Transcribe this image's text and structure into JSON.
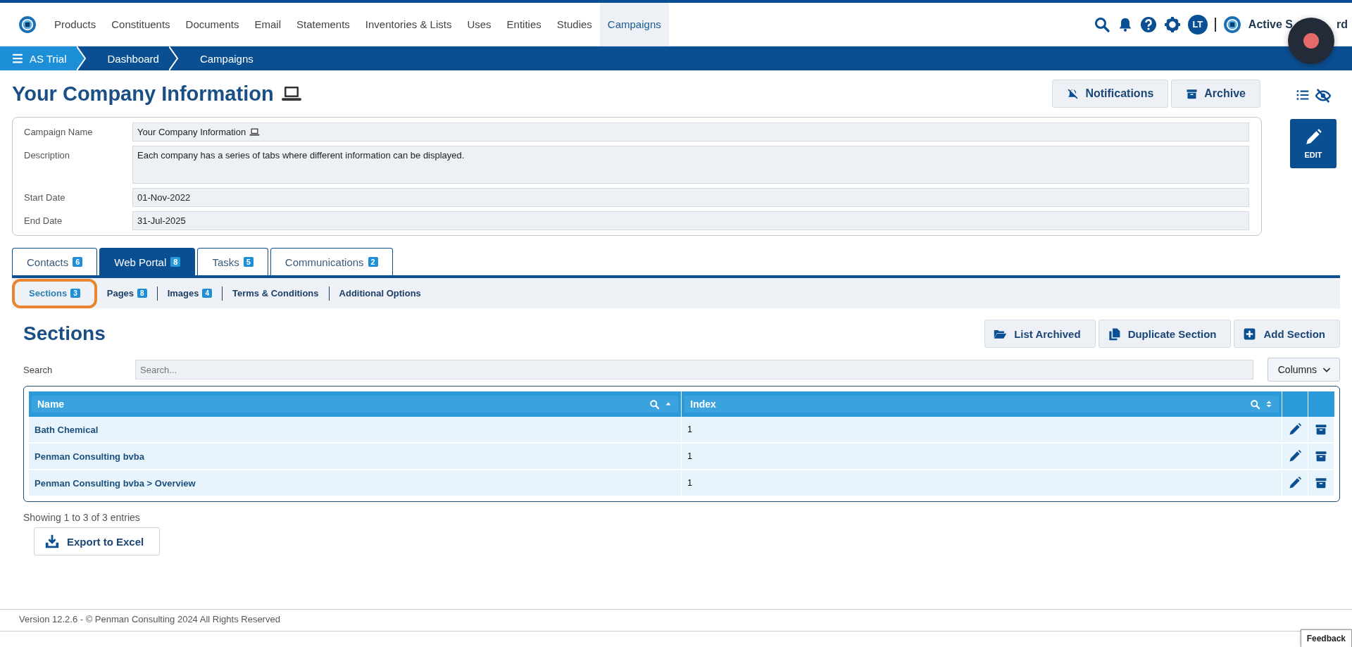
{
  "nav": {
    "items": [
      {
        "label": "Products",
        "selected": false
      },
      {
        "label": "Constituents",
        "selected": false
      },
      {
        "label": "Documents",
        "selected": false
      },
      {
        "label": "Email",
        "selected": false
      },
      {
        "label": "Statements",
        "selected": false
      },
      {
        "label": "Inventories & Lists",
        "selected": false
      },
      {
        "label": "Uses",
        "selected": false
      },
      {
        "label": "Entities",
        "selected": false
      },
      {
        "label": "Studies",
        "selected": false
      },
      {
        "label": "Campaigns",
        "selected": true
      }
    ],
    "avatar": "LT",
    "account_label": "Active S",
    "account_label_tail": "rd"
  },
  "breadcrumb": [
    "AS Trial",
    "Dashboard",
    "Campaigns"
  ],
  "page": {
    "title": "Your Company Information",
    "actions": [
      "Notifications",
      "Archive"
    ],
    "edit_button": "EDIT"
  },
  "form": {
    "fields": [
      {
        "label": "Campaign Name",
        "value": "Your Company Information",
        "kind": "input"
      },
      {
        "label": "Description",
        "value": "Each company has a series of tabs where different information can be displayed.",
        "kind": "textarea"
      },
      {
        "label": "Start Date",
        "value": "01-Nov-2022",
        "kind": "input"
      },
      {
        "label": "End Date",
        "value": "31-Jul-2025",
        "kind": "input"
      }
    ]
  },
  "tabs": [
    {
      "label": "Contacts",
      "count": "6",
      "selected": false
    },
    {
      "label": "Web Portal",
      "count": "8",
      "selected": true
    },
    {
      "label": "Tasks",
      "count": "5",
      "selected": false
    },
    {
      "label": "Communications",
      "count": "2",
      "selected": false
    }
  ],
  "subtabs": [
    {
      "label": "Sections",
      "count": "3",
      "selected": true,
      "highlighted": true
    },
    {
      "label": "Pages",
      "count": "8",
      "selected": false,
      "highlighted": false
    },
    {
      "label": "Images",
      "count": "4",
      "selected": false,
      "highlighted": false
    },
    {
      "label": "Terms & Conditions",
      "selected": false,
      "highlighted": false
    },
    {
      "label": "Additional Options",
      "selected": false,
      "highlighted": false
    }
  ],
  "sections": {
    "heading": "Sections",
    "buttons": [
      "List Archived",
      "Duplicate Section",
      "Add Section"
    ],
    "search": {
      "label": "Search",
      "placeholder": "Search..."
    },
    "columns_button": "Columns",
    "table": {
      "columns": [
        "Name",
        "Index"
      ],
      "rows": [
        [
          "Bath Chemical",
          "1"
        ],
        [
          "Penman Consulting bvba",
          "1"
        ],
        [
          "Penman Consulting bvba > Overview",
          "1"
        ]
      ]
    },
    "info": "Showing 1 to 3 of 3 entries",
    "export": "Export to Excel"
  },
  "footer": "Version 12.2.6 - © Penman Consulting 2024 All Rights Reserved",
  "feedback": "Feedback"
}
